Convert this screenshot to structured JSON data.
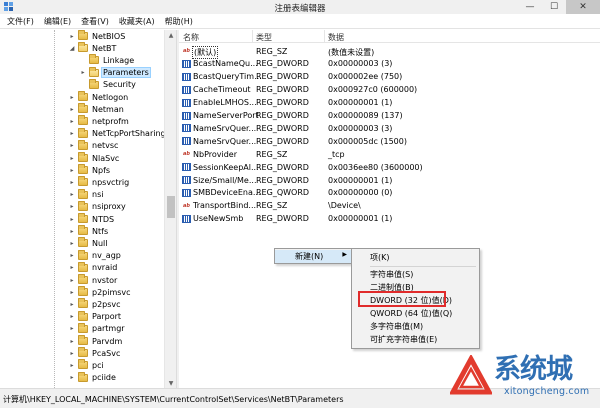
{
  "window": {
    "title": "注册表编辑器",
    "minimize": "—",
    "maximize": "☐",
    "close": "✕"
  },
  "menu": [
    "文件(F)",
    "编辑(E)",
    "查看(V)",
    "收藏夹(A)",
    "帮助(H)"
  ],
  "tree": [
    {
      "label": "NetBIOS",
      "expander": "▸",
      "selected": false
    },
    {
      "label": "NetBT",
      "expander": "◢",
      "selected": false
    },
    {
      "label": "Linkage",
      "expander": "",
      "selected": false
    },
    {
      "label": "Parameters",
      "expander": "▸",
      "selected": true
    },
    {
      "label": "Security",
      "expander": "",
      "selected": false
    },
    {
      "label": "Netlogon",
      "expander": "▸",
      "selected": false
    },
    {
      "label": "Netman",
      "expander": "▸",
      "selected": false
    },
    {
      "label": "netprofm",
      "expander": "▸",
      "selected": false
    },
    {
      "label": "NetTcpPortSharing",
      "expander": "▸",
      "selected": false
    },
    {
      "label": "netvsc",
      "expander": "▸",
      "selected": false
    },
    {
      "label": "NlaSvc",
      "expander": "▸",
      "selected": false
    },
    {
      "label": "Npfs",
      "expander": "▸",
      "selected": false
    },
    {
      "label": "npsvctrig",
      "expander": "▸",
      "selected": false
    },
    {
      "label": "nsi",
      "expander": "▸",
      "selected": false
    },
    {
      "label": "nsiproxy",
      "expander": "▸",
      "selected": false
    },
    {
      "label": "NTDS",
      "expander": "▸",
      "selected": false
    },
    {
      "label": "Ntfs",
      "expander": "▸",
      "selected": false
    },
    {
      "label": "Null",
      "expander": "▸",
      "selected": false
    },
    {
      "label": "nv_agp",
      "expander": "▸",
      "selected": false
    },
    {
      "label": "nvraid",
      "expander": "▸",
      "selected": false
    },
    {
      "label": "nvstor",
      "expander": "▸",
      "selected": false
    },
    {
      "label": "p2pimsvc",
      "expander": "▸",
      "selected": false
    },
    {
      "label": "p2psvc",
      "expander": "▸",
      "selected": false
    },
    {
      "label": "Parport",
      "expander": "▸",
      "selected": false
    },
    {
      "label": "partmgr",
      "expander": "▸",
      "selected": false
    },
    {
      "label": "Parvdm",
      "expander": "▸",
      "selected": false
    },
    {
      "label": "PcaSvc",
      "expander": "▸",
      "selected": false
    },
    {
      "label": "pci",
      "expander": "▸",
      "selected": false
    },
    {
      "label": "pciide",
      "expander": "▸",
      "selected": false
    }
  ],
  "columns": {
    "name": "名称",
    "type": "类型",
    "data": "数据"
  },
  "values": [
    {
      "icon": "ab",
      "name": "(默认)",
      "type": "REG_SZ",
      "data": "(数值未设置)"
    },
    {
      "icon": "dw",
      "name": "BcastNameQu...",
      "type": "REG_DWORD",
      "data": "0x00000003 (3)"
    },
    {
      "icon": "dw",
      "name": "BcastQueryTim...",
      "type": "REG_DWORD",
      "data": "0x000002ee (750)"
    },
    {
      "icon": "dw",
      "name": "CacheTimeout",
      "type": "REG_DWORD",
      "data": "0x000927c0 (600000)"
    },
    {
      "icon": "dw",
      "name": "EnableLMHOS...",
      "type": "REG_DWORD",
      "data": "0x00000001 (1)"
    },
    {
      "icon": "dw",
      "name": "NameServerPort",
      "type": "REG_DWORD",
      "data": "0x00000089 (137)"
    },
    {
      "icon": "dw",
      "name": "NameSrvQuer...",
      "type": "REG_DWORD",
      "data": "0x00000003 (3)"
    },
    {
      "icon": "dw",
      "name": "NameSrvQuer...",
      "type": "REG_DWORD",
      "data": "0x000005dc (1500)"
    },
    {
      "icon": "ab",
      "name": "NbProvider",
      "type": "REG_SZ",
      "data": "_tcp"
    },
    {
      "icon": "dw",
      "name": "SessionKeepAl...",
      "type": "REG_DWORD",
      "data": "0x0036ee80 (3600000)"
    },
    {
      "icon": "dw",
      "name": "Size/Small/Me...",
      "type": "REG_DWORD",
      "data": "0x00000001 (1)"
    },
    {
      "icon": "dw",
      "name": "SMBDeviceEna...",
      "type": "REG_QWORD",
      "data": "0x00000000 (0)"
    },
    {
      "icon": "ab",
      "name": "TransportBind...",
      "type": "REG_SZ",
      "data": "\\Device\\"
    },
    {
      "icon": "dw",
      "name": "UseNewSmb",
      "type": "REG_DWORD",
      "data": "0x00000001 (1)"
    }
  ],
  "context_menu": {
    "new_label": "新建(N)",
    "sub_arrow": "▶"
  },
  "submenu": {
    "key": "项(K)",
    "string": "字符串值(S)",
    "binary": "二进制值(B)",
    "dword": "DWORD (32 位)值(D)",
    "qword": "QWORD (64 位)值(Q)",
    "multi_string": "多字符串值(M)",
    "expandable_string": "可扩充字符串值(E)"
  },
  "status": "计算机\\HKEY_LOCAL_MACHINE\\SYSTEM\\CurrentControlSet\\Services\\NetBT\\Parameters",
  "watermark": {
    "brand": "系统城",
    "url": "xitongcheng.com"
  },
  "colors": {
    "selection": "#cde8ff",
    "menu_hover": "#d6e9f8",
    "highlight_box": "#e02b2b",
    "watermark": "#2f6fb3"
  }
}
